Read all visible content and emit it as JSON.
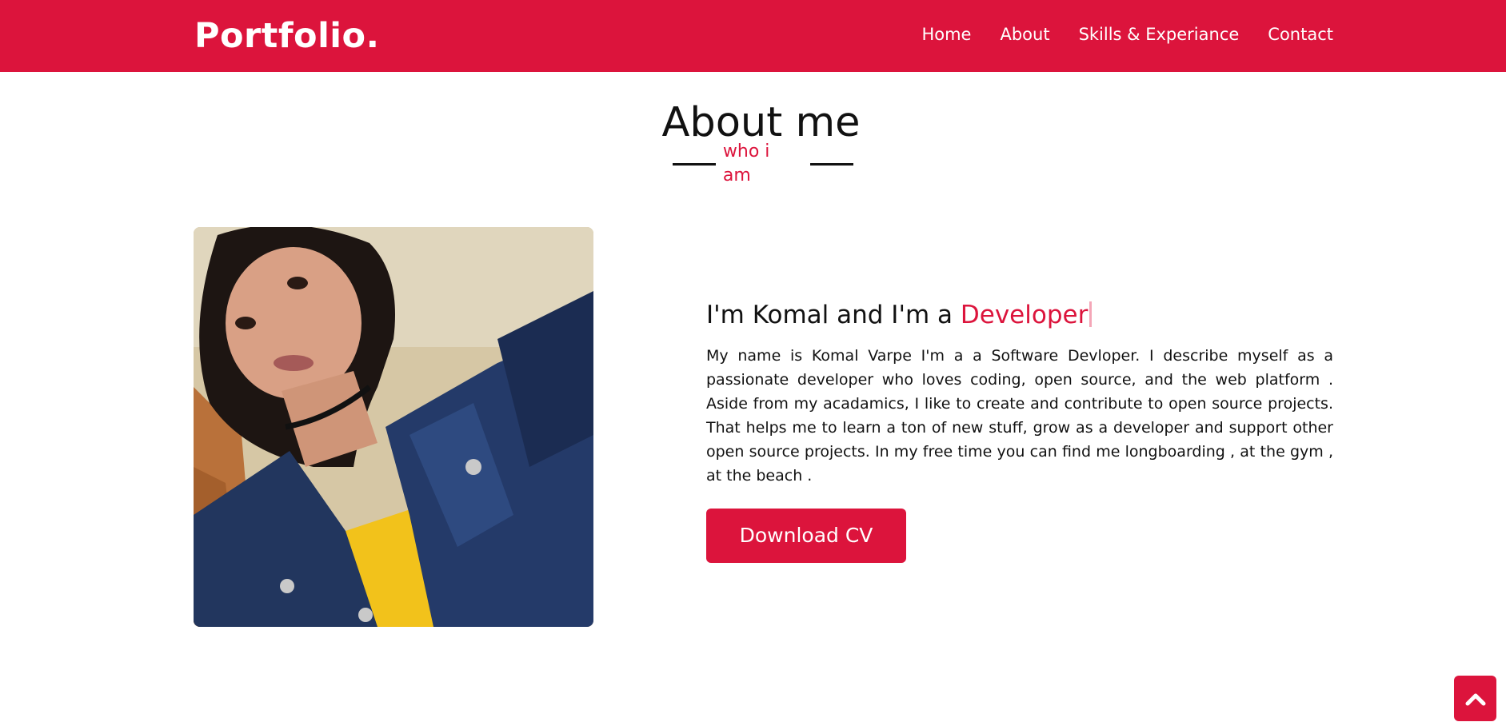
{
  "header": {
    "logo": "Portfolio.",
    "nav": [
      {
        "label": "Home"
      },
      {
        "label": "About"
      },
      {
        "label": "Skills & Experiance"
      },
      {
        "label": "Contact"
      }
    ]
  },
  "about": {
    "title": "About me",
    "subtitle": "who i am",
    "intro_prefix": "I'm Komal and I'm a ",
    "intro_role": "Developer",
    "bio": "My name is Komal Varpe I'm a a Software Devloper. I describe myself as a passionate developer who loves coding, open source, and the web platform . Aside from my acadamics, I like to create and contribute to open source projects. That helps me to learn a ton of new stuff, grow as a developer and support other open source projects. In my free time you can find me longboarding , at the gym , at the beach .",
    "cv_button": "Download CV"
  },
  "colors": {
    "accent": "#dc143c",
    "text": "#111111",
    "background": "#ffffff"
  },
  "icons": {
    "scroll_top": "chevron-up-icon"
  }
}
